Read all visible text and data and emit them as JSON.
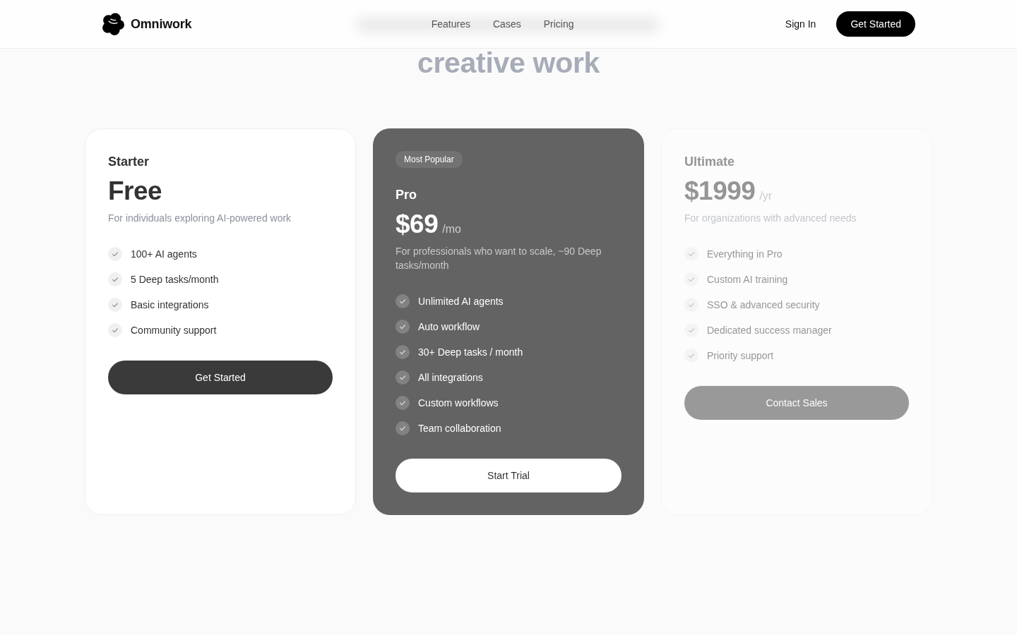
{
  "header": {
    "brand": "Omniwork",
    "nav": [
      "Features",
      "Cases",
      "Pricing"
    ],
    "sign_in": "Sign In",
    "cta": "Get Started"
  },
  "pricing": {
    "heading": "creative work",
    "plans": [
      {
        "kind": "standard",
        "dimmed": false,
        "name": "Starter",
        "price": "Free",
        "description": "For individuals exploring AI-powered work",
        "features": [
          "100+ AI agents",
          "5 Deep tasks/month",
          "Basic integrations",
          "Community support"
        ],
        "button": "Get Started"
      },
      {
        "kind": "featured",
        "dimmed": false,
        "badge": "Most Popular",
        "name": "Pro",
        "price": "$69",
        "period": "/mo",
        "description": "For professionals who want to scale, ~90 Deep tasks/month",
        "features": [
          "Unlimited AI agents",
          "Auto workflow",
          "30+ Deep tasks / month",
          "All integrations",
          "Custom workflows",
          "Team collaboration"
        ],
        "button": "Start Trial"
      },
      {
        "kind": "standard",
        "dimmed": true,
        "name": "Ultimate",
        "price": "$1999",
        "period": "/yr",
        "description": "For organizations with advanced needs",
        "features": [
          "Everything in Pro",
          "Custom AI training",
          "SSO & advanced security",
          "Dedicated success manager",
          "Priority support"
        ],
        "button": "Contact Sales"
      }
    ]
  }
}
